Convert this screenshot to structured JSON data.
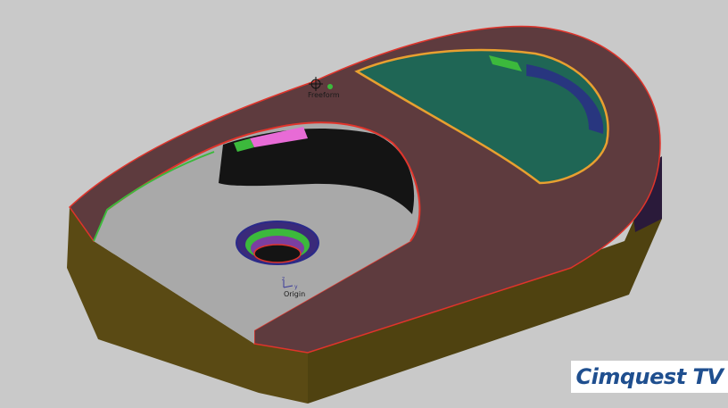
{
  "viewport": {
    "background_color": "#c9c9c9",
    "freeform_label": "Freeform",
    "origin_label": "Origin",
    "origin_axis_z": "z",
    "origin_axis_y": "y"
  },
  "brand": {
    "text": "Cimquest TV",
    "color": "#1f4f8f"
  },
  "model": {
    "top_surface_color": "#5e3b3e",
    "side_wall_color": "#5a4a14",
    "floor_color": "#a9a9a9",
    "pocket_color": "#1f6655",
    "edge_highlight_colors": [
      "#e0342b",
      "#3cb93c",
      "#e86bd6",
      "#e8a030",
      "#2a2a8a"
    ]
  }
}
